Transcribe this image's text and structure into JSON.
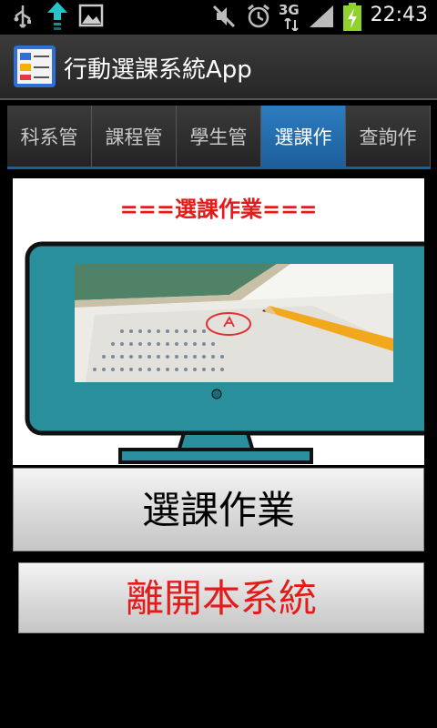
{
  "status_bar": {
    "time": "22:43",
    "network_label": "3G",
    "icons": [
      "usb-icon",
      "upload-icon",
      "image-icon",
      "mute-icon",
      "alarm-icon",
      "network-3g-icon",
      "signal-icon",
      "battery-charging-icon"
    ]
  },
  "app": {
    "title": "行動選課系統App",
    "icon": "app-list-icon"
  },
  "tabs": [
    {
      "label": "科系管",
      "active": false
    },
    {
      "label": "課程管",
      "active": false
    },
    {
      "label": "學生管",
      "active": false
    },
    {
      "label": "選課作",
      "active": true
    },
    {
      "label": "查詢作",
      "active": false
    }
  ],
  "panel": {
    "heading": "===選課作業===",
    "illustration": "monitor-with-exam-sheet-image"
  },
  "buttons": {
    "select_course": "選課作業",
    "exit_system": "離開本系統"
  },
  "colors": {
    "accent_red": "#e31b1b",
    "tab_active": "#2d7cc0",
    "monitor_teal": "#2a8f9c"
  }
}
